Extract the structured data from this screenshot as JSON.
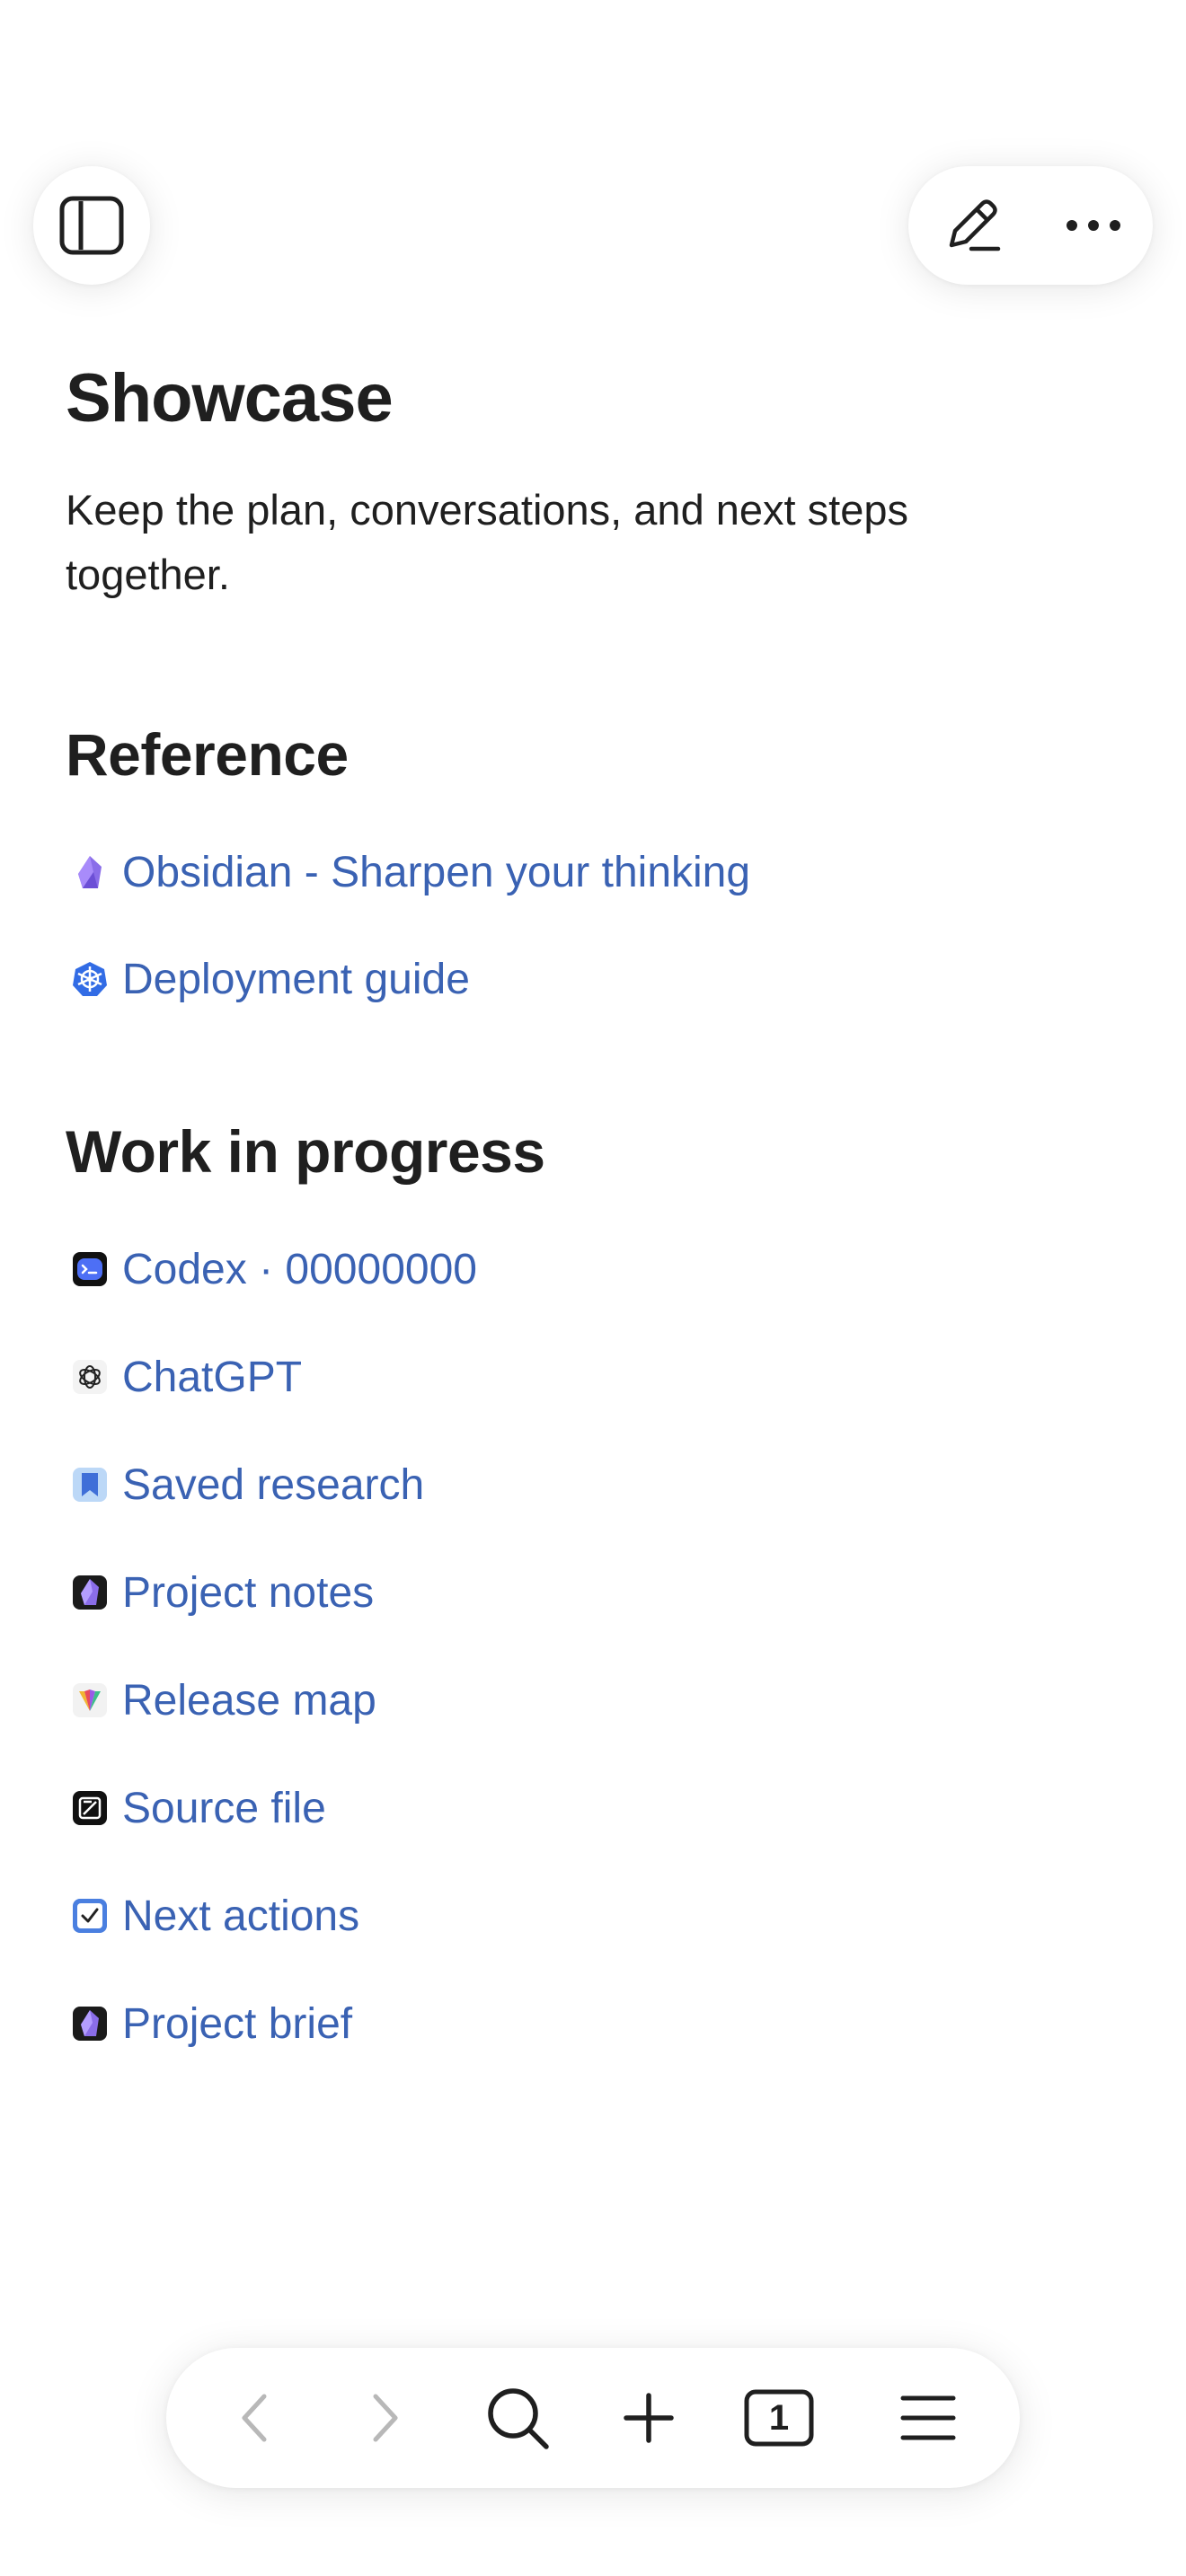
{
  "header": {
    "sidebar_icon": "sidebar-toggle-icon",
    "edit_icon": "pencil-icon",
    "more_icon": "ellipsis-icon"
  },
  "page": {
    "title": "Showcase",
    "description": "Keep the plan, conversations, and next steps together."
  },
  "sections": [
    {
      "heading": "Reference",
      "links": [
        {
          "label": "Obsidian - Sharpen your thinking",
          "icon": "obsidian-icon"
        },
        {
          "label": "Deployment guide",
          "icon": "kubernetes-icon"
        }
      ]
    },
    {
      "heading": "Work in progress",
      "links": [
        {
          "label": "Codex · 00000000",
          "icon": "codex-icon"
        },
        {
          "label": "ChatGPT",
          "icon": "openai-icon"
        },
        {
          "label": "Saved research",
          "icon": "bookmark-icon"
        },
        {
          "label": "Project notes",
          "icon": "obsidian-dark-icon"
        },
        {
          "label": "Release map",
          "icon": "multicolor-app-icon"
        },
        {
          "label": "Source file",
          "icon": "editor-icon"
        },
        {
          "label": "Next actions",
          "icon": "checkbox-icon"
        },
        {
          "label": "Project brief",
          "icon": "obsidian-dark-icon"
        }
      ]
    }
  ],
  "toolbar": {
    "tab_count": "1",
    "items": [
      "back-icon",
      "forward-icon",
      "search-icon",
      "plus-icon",
      "tabs-icon",
      "menu-icon"
    ]
  },
  "colors": {
    "link": "#3a62b3",
    "text": "#1f1f1f",
    "disabled": "#b8b8b8"
  }
}
